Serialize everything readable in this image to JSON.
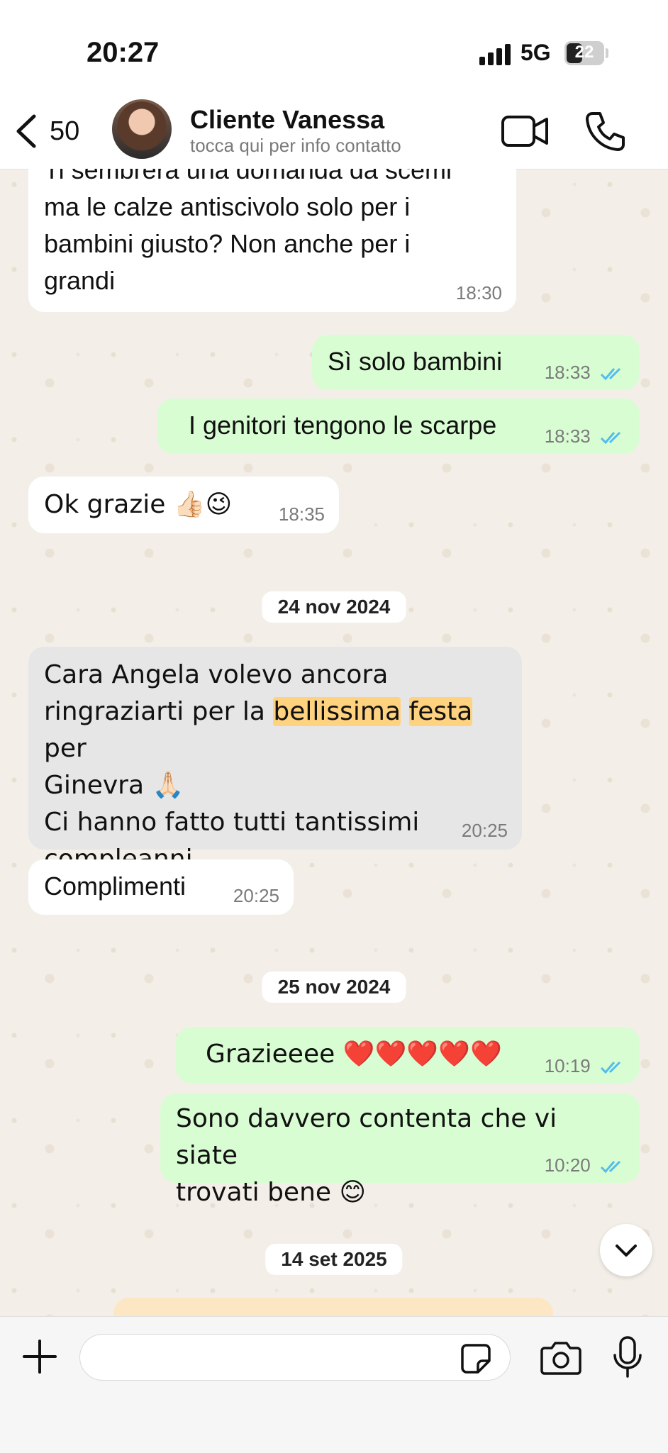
{
  "status": {
    "time": "20:27",
    "network": "5G",
    "battery": "22"
  },
  "header": {
    "back_count": "50",
    "contact_name": "Cliente Vanessa",
    "contact_sub": "tocca qui per info contatto"
  },
  "messages": [
    {
      "text": "Ti sembrerà una domanda da scemi\nma le calze antiscivolo solo per i\nbambini giusto? Non anche per i\ngrandi",
      "time": "18:30"
    },
    {
      "text": "Sì solo bambini",
      "time": "18:33"
    },
    {
      "text": "I genitori tengono le scarpe",
      "time": "18:33"
    },
    {
      "text": "Ok grazie 👍🏻😉",
      "time": "18:35"
    },
    {
      "text_part1": "Cara Angela volevo ancora\nringraziarti per la ",
      "highlight1": "bellissima",
      "highlight2": "festa",
      "text_part2": " per\nGinevra 🙏🏻\nCi hanno fatto tutti tantissimi\ncompleanni",
      "time": "20:25"
    },
    {
      "text": "Complimenti",
      "time": "20:25"
    },
    {
      "text": "Grazieeee ❤️❤️❤️❤️❤️",
      "time": "10:19"
    },
    {
      "text": "Sono davvero contenta che vi siate\ntrovati bene 😊",
      "time": "10:20"
    }
  ],
  "dates": [
    "24 nov 2024",
    "25 nov 2024",
    "14 set 2025"
  ],
  "colors": {
    "incoming": "#ffffff",
    "outgoing": "#d9fdd3",
    "highlight": "#ffd27f",
    "read_ticks": "#53bdeb"
  },
  "icons": [
    "chevron-left-icon",
    "video-camera-icon",
    "phone-icon",
    "chevron-down-icon",
    "plus-icon",
    "sticker-icon",
    "camera-icon",
    "microphone-icon"
  ]
}
